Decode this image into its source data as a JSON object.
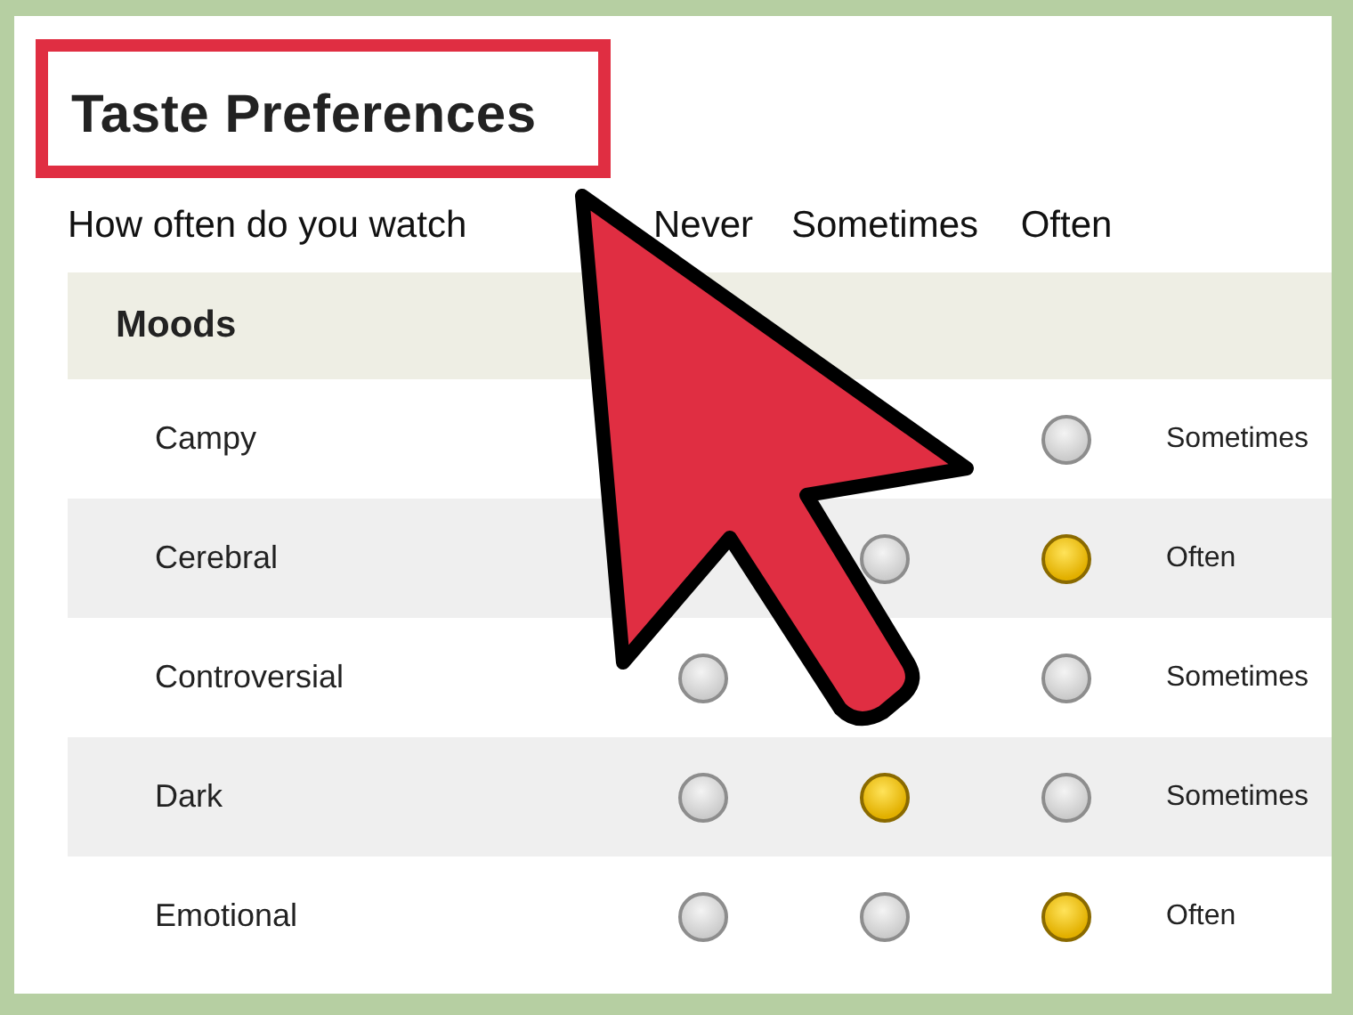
{
  "title": "Taste Preferences",
  "header": {
    "question": "How often do you watch",
    "columns": [
      "Never",
      "Sometimes",
      "Often"
    ]
  },
  "section": "Moods",
  "rows": [
    {
      "label": "Campy",
      "answer": "Sometimes",
      "radios": {
        "often": {
          "selected": false
        }
      }
    },
    {
      "label": "Cerebral",
      "answer": "Often",
      "radios": {
        "sometimes": {
          "selected": false
        },
        "often": {
          "selected": true
        }
      }
    },
    {
      "label": "Controversial",
      "answer": "Sometimes",
      "radios": {
        "never": {
          "selected": false
        },
        "often": {
          "selected": false
        }
      }
    },
    {
      "label": "Dark",
      "answer": "Sometimes",
      "radios": {
        "never": {
          "selected": false
        },
        "sometimes": {
          "selected": true
        },
        "often": {
          "selected": false
        }
      }
    },
    {
      "label": "Emotional",
      "answer": "Often",
      "radios": {
        "never": {
          "selected": false
        },
        "sometimes": {
          "selected": false
        },
        "often": {
          "selected": true
        }
      }
    }
  ]
}
